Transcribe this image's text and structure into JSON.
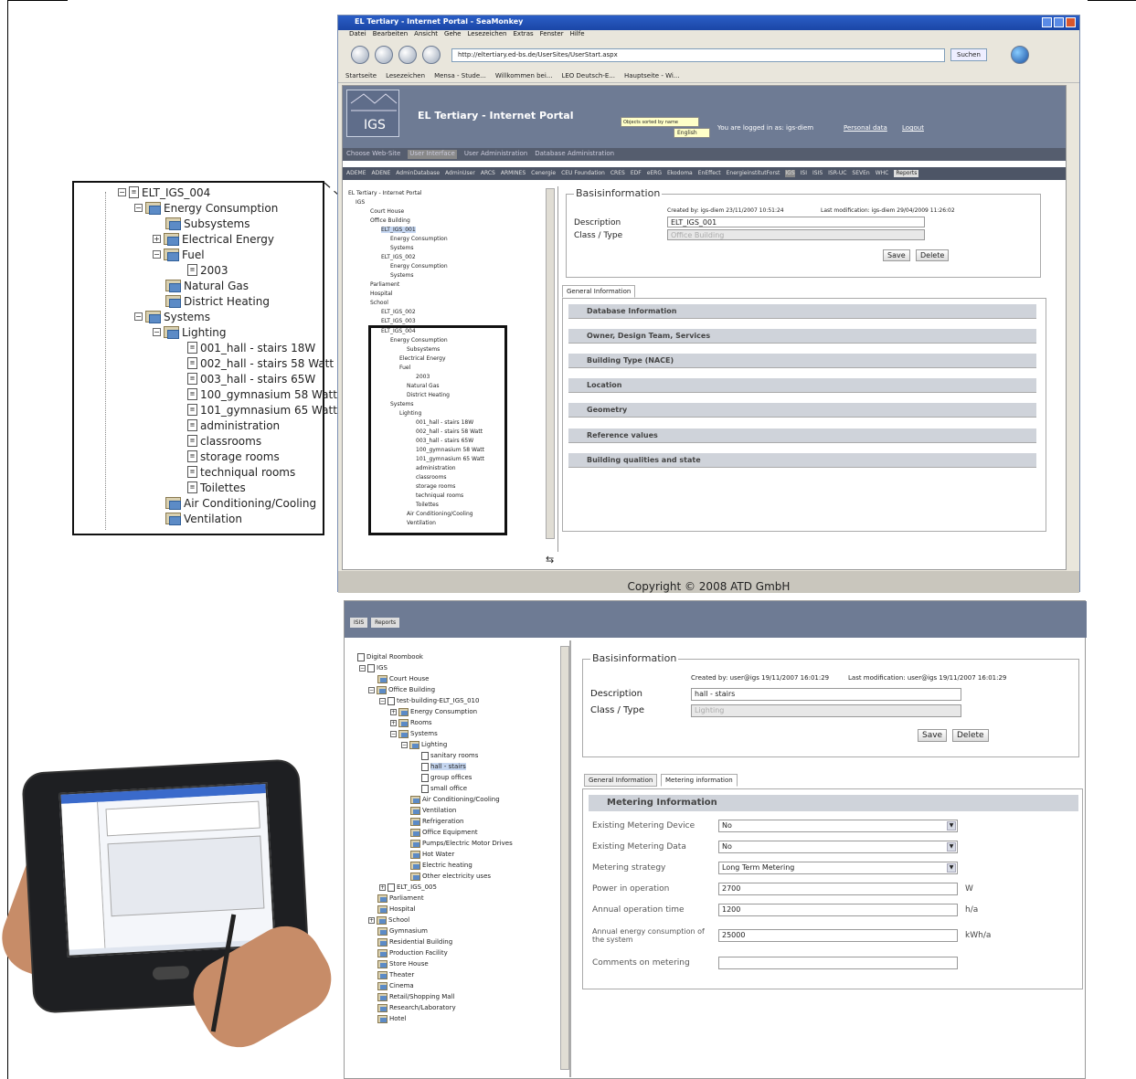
{
  "zoom_tree": {
    "root": "ELT_IGS_004",
    "items": [
      "Energy Consumption",
      "Subsystems",
      "Electrical Energy",
      "Fuel",
      "2003",
      "Natural Gas",
      "District Heating",
      "Systems",
      "Lighting",
      "001_hall - stairs 18W",
      "002_hall - stairs 58 Watt",
      "003_hall - stairs 65W",
      "100_gymnasium 58 Watt",
      "101_gymnasium 65 Watt",
      "administration",
      "classrooms",
      "storage rooms",
      "techniqual rooms",
      "Toilettes",
      "Air Conditioning/Cooling",
      "Ventilation"
    ]
  },
  "browser": {
    "title": "EL Tertiary - Internet Portal - SeaMonkey",
    "menu": [
      "Datei",
      "Bearbeiten",
      "Ansicht",
      "Gehe",
      "Lesezeichen",
      "Extras",
      "Fenster",
      "Hilfe"
    ],
    "url": "http://eltertiary.ed-bs.de/UserSites/UserStart.aspx",
    "search_label": "Suchen",
    "bookmarks": [
      "Startseite",
      "Lesezeichen",
      "Mensa - Stude...",
      "Willkommen bei...",
      "LEO Deutsch-E...",
      "Hauptseite - Wi..."
    ],
    "portal_title": "EL Tertiary - Internet Portal",
    "logo_text": "IGS",
    "sort_label": "Objects sorted by name",
    "language": "English",
    "logged_in": "You are logged in as:  igs-diem",
    "personal_data": "Personal data",
    "logout": "Logout",
    "choose_site": "Choose Web-Site",
    "site_tabs": [
      "User Interface",
      "User Administration",
      "Database Administration"
    ],
    "partner_tabs": [
      "ADEME",
      "ADENE",
      "AdminDatabase",
      "AdminUser",
      "ARCS",
      "ARMINES",
      "Cenergie",
      "CEU Foundation",
      "CRES",
      "EDF",
      "eERG",
      "Ekodoma",
      "EnEffect",
      "EnergieinstitutForst",
      "IGS",
      "ISI",
      "ISIS",
      "ISR-UC",
      "SEVEn",
      "WHC",
      "Reports"
    ],
    "tree": [
      "EL Tertiary - Internet Portal",
      "IGS",
      "Court House",
      "Office Building",
      "ELT_IGS_001",
      "Energy Consumption",
      "Systems",
      "ELT_IGS_002",
      "Energy Consumption",
      "Systems",
      "Parliament",
      "Hospital",
      "School",
      "ELT_IGS_002",
      "ELT_IGS_003",
      "ELT_IGS_004",
      "Energy Consumption",
      "Subsystems",
      "Electrical Energy",
      "Fuel",
      "2003",
      "Natural Gas",
      "District Heating",
      "Systems",
      "Lighting",
      "001_hall - stairs 18W",
      "002_hall - stairs 58 Watt",
      "003_hall - stairs 65W",
      "100_gymnasium 58 Watt",
      "101_gymnasium 65 Watt",
      "administration",
      "classrooms",
      "storage rooms",
      "techniqual rooms",
      "Toilettes",
      "Air Conditioning/Cooling",
      "Ventilation"
    ],
    "basis_legend": "Basisinformation",
    "created_by": "Created by:   igs-diem   23/11/2007 10:51:24",
    "last_mod": "Last modification:   igs-diem   29/04/2009 11:26:02",
    "desc_label": "Description",
    "desc_value": "ELT_IGS_001",
    "class_label": "Class / Type",
    "class_value": "Office Building",
    "save": "Save",
    "delete": "Delete",
    "tab_general": "General Information",
    "sections": [
      "Database Information",
      "Owner, Design Team, Services",
      "Building Type (NACE)",
      "Location",
      "Geometry",
      "Reference values",
      "Building qualities and state"
    ],
    "copyright": "Copyright © 2008 ATD GmbH"
  },
  "portal2": {
    "toolbar_a": "ISIS",
    "toolbar_reports": "Reports",
    "tree": [
      "Digital Roombook",
      "IGS",
      "Court House",
      "Office Building",
      "test-building-ELT_IGS_010",
      "Energy Consumption",
      "Rooms",
      "Systems",
      "Lighting",
      "sanitary rooms",
      "hall - stairs",
      "group offices",
      "small office",
      "Air Conditioning/Cooling",
      "Ventilation",
      "Refrigeration",
      "Office Equipment",
      "Pumps/Electric Motor Drives",
      "Hot Water",
      "Electric heating",
      "Other electricity uses",
      "ELT_IGS_005",
      "Parliament",
      "Hospital",
      "School",
      "Gymnasium",
      "Residential Building",
      "Production Facility",
      "Store House",
      "Theater",
      "Cinema",
      "Retail/Shopping Mall",
      "Research/Laboratory",
      "Hotel"
    ],
    "basis_legend": "Basisinformation",
    "created_by": "Created by:   user@igs   19/11/2007 16:01:29",
    "last_mod": "Last modification:   user@igs   19/11/2007 16:01:29",
    "desc_label": "Description",
    "desc_value": "hall - stairs",
    "class_label": "Class / Type",
    "class_value": "Lighting",
    "save": "Save",
    "delete": "Delete",
    "tab_general": "General Information",
    "tab_metering": "Metering information",
    "metering_title": "Metering Information",
    "fields": [
      {
        "label": "Existing Metering Device",
        "value": "No",
        "unit": ""
      },
      {
        "label": "Existing Metering Data",
        "value": "No",
        "unit": ""
      },
      {
        "label": "Metering strategy",
        "value": "Long Term Metering",
        "unit": ""
      },
      {
        "label": "Power in operation",
        "value": "2700",
        "unit": "W"
      },
      {
        "label": "Annual operation time",
        "value": "1200",
        "unit": "h/a"
      },
      {
        "label": "Annual energy consumption of the system",
        "value": "25000",
        "unit": "kWh/a"
      },
      {
        "label": "Comments on metering",
        "value": "",
        "unit": ""
      }
    ]
  }
}
